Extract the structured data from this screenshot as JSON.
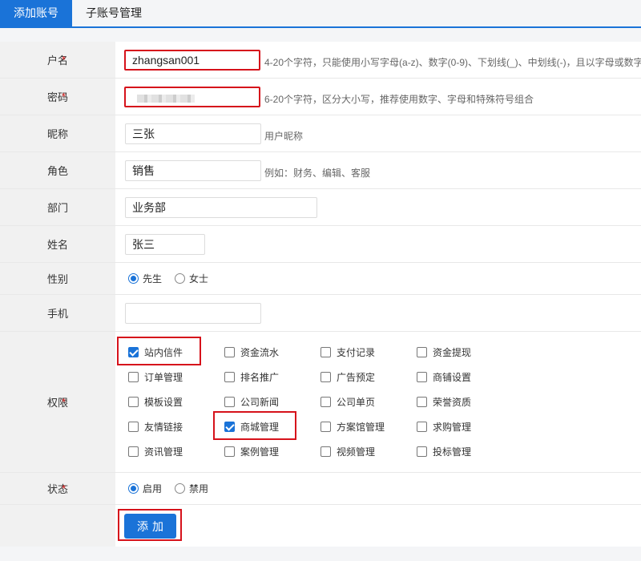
{
  "tabs": [
    {
      "label": "添加账号",
      "active": true
    },
    {
      "label": "子账号管理",
      "active": false
    }
  ],
  "fields": {
    "username": {
      "label": "户名",
      "required": true,
      "value": "zhangsan001",
      "hint": "4-20个字符，只能使用小写字母(a-z)、数字(0-9)、下划线(_)、中划线(-)，且以字母或数字"
    },
    "password": {
      "label": "密码",
      "required": true,
      "value": "",
      "hint": "6-20个字符，区分大小写，推荐使用数字、字母和特殊符号组合"
    },
    "nickname": {
      "label": "昵称",
      "value": "三张",
      "hint": "用户昵称"
    },
    "role": {
      "label": "角色",
      "value": "销售",
      "hint": "例如：财务、编辑、客服"
    },
    "department": {
      "label": "部门",
      "value": "业务部"
    },
    "name": {
      "label": "姓名",
      "value": "张三"
    },
    "gender": {
      "label": "性别",
      "options": [
        "先生",
        "女士"
      ],
      "selected": "先生"
    },
    "phone": {
      "label": "手机",
      "value": ""
    }
  },
  "permissions": {
    "label": "权限",
    "required": true,
    "items": [
      {
        "label": "站内信件",
        "checked": true
      },
      {
        "label": "资金流水",
        "checked": false
      },
      {
        "label": "支付记录",
        "checked": false
      },
      {
        "label": "资金提现",
        "checked": false
      },
      {
        "label": "订单管理",
        "checked": false
      },
      {
        "label": "排名推广",
        "checked": false
      },
      {
        "label": "广告预定",
        "checked": false
      },
      {
        "label": "商铺设置",
        "checked": false
      },
      {
        "label": "模板设置",
        "checked": false
      },
      {
        "label": "公司新闻",
        "checked": false
      },
      {
        "label": "公司单页",
        "checked": false
      },
      {
        "label": "荣誉资质",
        "checked": false
      },
      {
        "label": "友情链接",
        "checked": false
      },
      {
        "label": "商城管理",
        "checked": true
      },
      {
        "label": "方案馆管理",
        "checked": false
      },
      {
        "label": "求购管理",
        "checked": false
      },
      {
        "label": "资讯管理",
        "checked": false
      },
      {
        "label": "案例管理",
        "checked": false
      },
      {
        "label": "视频管理",
        "checked": false
      },
      {
        "label": "投标管理",
        "checked": false
      }
    ]
  },
  "status": {
    "label": "状态",
    "required": true,
    "options": [
      "启用",
      "禁用"
    ],
    "selected": "启用"
  },
  "submit_label": "添加",
  "colors": {
    "accent": "#1a73d8",
    "highlight": "#d6121b",
    "required": "#e02020"
  }
}
